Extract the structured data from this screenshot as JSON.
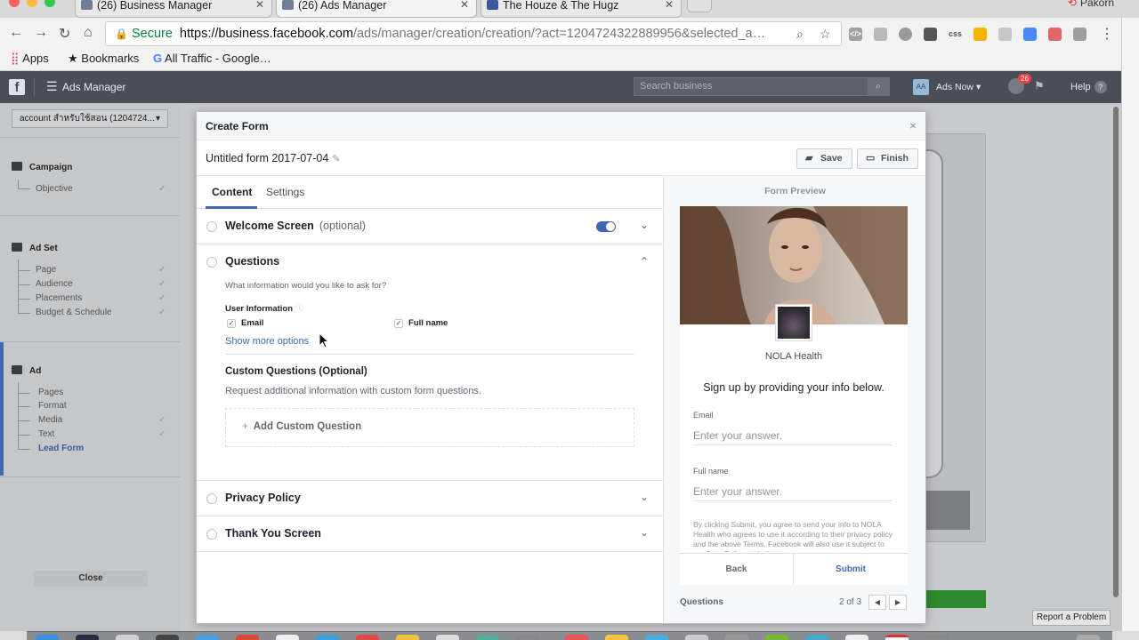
{
  "browser": {
    "tabs": [
      {
        "title": "(26) Business Manager",
        "active": false
      },
      {
        "title": "(26) Ads Manager",
        "active": true
      },
      {
        "title": "The Houze & The Hugz",
        "active": false
      }
    ],
    "user": "Pakorn",
    "secure_label": "Secure",
    "url_host": "https://business.facebook.com",
    "url_path": "/ads/manager/creation/creation/?act=1204724322889956&selected_a…",
    "bookmarks": [
      {
        "label": "Apps",
        "icon": "apps-grid-icon"
      },
      {
        "label": "Bookmarks",
        "icon": "star-icon"
      },
      {
        "label": "All Traffic - Google…",
        "icon": "google-icon"
      }
    ]
  },
  "fb_header": {
    "title": "Ads Manager",
    "search_placeholder": "Search business",
    "account_initials": "AA",
    "account_name": "Ads Now",
    "notification_count": "26",
    "help_label": "Help"
  },
  "sidebar": {
    "account": "account สำหรับใช้สอน (1204724...",
    "campaign": {
      "title": "Campaign",
      "items": [
        "Objective"
      ]
    },
    "adset": {
      "title": "Ad Set",
      "items": [
        "Page",
        "Audience",
        "Placements",
        "Budget & Schedule"
      ]
    },
    "ad": {
      "title": "Ad",
      "items": [
        "Pages",
        "Format",
        "Media",
        "Text",
        "Lead Form"
      ]
    },
    "close_label": "Close"
  },
  "modal": {
    "title": "Create Form",
    "form_name": "Untitled form 2017-07-04",
    "save_label": "Save",
    "finish_label": "Finish",
    "tabs": [
      "Content",
      "Settings"
    ],
    "sections": {
      "welcome": {
        "title": "Welcome Screen",
        "optional": "(optional)",
        "enabled": true
      },
      "questions": {
        "title": "Questions",
        "prompt": "What information would you like to ask for?",
        "user_info_label": "User Information",
        "fields": [
          {
            "label": "Email",
            "checked": true
          },
          {
            "label": "Full name",
            "checked": true
          }
        ],
        "show_more": "Show more options",
        "custom_title": "Custom Questions (Optional)",
        "custom_desc": "Request additional information with custom form questions.",
        "add_custom": "Add Custom Question"
      },
      "privacy": {
        "title": "Privacy Policy"
      },
      "thankyou": {
        "title": "Thank You Screen"
      }
    },
    "preview": {
      "title": "Form Preview",
      "page_name": "NOLA Health",
      "headline": "Sign up by providing your info below.",
      "fields": [
        {
          "label": "Email",
          "placeholder": "Enter your answer."
        },
        {
          "label": "Full name",
          "placeholder": "Enter your answer."
        }
      ],
      "disclaimer": "By clicking Submit, you agree to send your info to NOLA Health who agrees to use it according to their privacy policy and the above Terms. Facebook will also use it subject to our Data Policy, including to",
      "back_label": "Back",
      "submit_label": "Submit",
      "footer_label": "Questions",
      "page_count": "2 of 3"
    }
  },
  "background": {
    "report_problem": "Report a Problem"
  }
}
